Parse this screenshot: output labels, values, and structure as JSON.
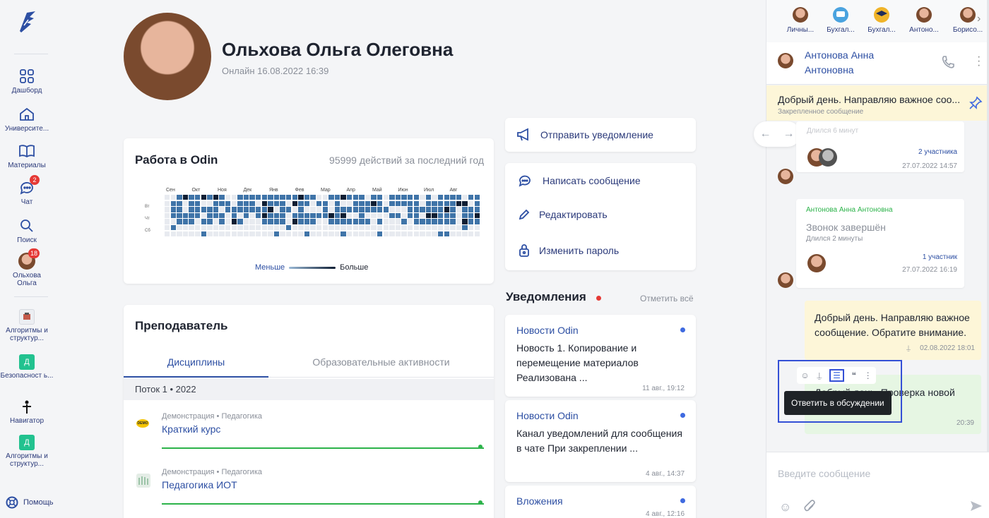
{
  "nav": {
    "items": [
      {
        "label": "Дашборд",
        "icon": "dashboard-icon"
      },
      {
        "label": "Университе...",
        "icon": "university-icon"
      },
      {
        "label": "Материалы",
        "icon": "book-icon"
      },
      {
        "label": "Чат",
        "icon": "chat-icon",
        "badge": "2"
      },
      {
        "label": "Поиск",
        "icon": "search-icon"
      },
      {
        "label": "Ольхова\nОльга",
        "icon": "avatar",
        "badge": "18"
      }
    ],
    "groups": [
      {
        "label": "Алгоритмы и структур...",
        "tile": ""
      },
      {
        "label": "Безопасност ь...",
        "tile": "Д"
      },
      {
        "label": "Навигатор",
        "tile": ""
      },
      {
        "label": "Алгоритмы и структур...",
        "tile": "Д"
      }
    ],
    "help": "Помощь"
  },
  "profile": {
    "name": "Ольхова Ольга Олеговна",
    "status": "Онлайн 16.08.2022 16:39"
  },
  "activity": {
    "title": "Работа в Odin",
    "summary": "95999 действий за последний год",
    "months": [
      "Сен",
      "Окт",
      "Ноя",
      "Дек",
      "Янв",
      "Фев",
      "Мар",
      "Апр",
      "Май",
      "Июн",
      "Июл",
      "Авг"
    ],
    "days": [
      "Вт",
      "Чт",
      "Сб"
    ],
    "legend_less": "Меньше",
    "legend_more": "Больше"
  },
  "actions": {
    "notify": "Отправить уведомление",
    "message": "Написать сообщение",
    "edit": "Редактировать",
    "password": "Изменить пароль"
  },
  "teacher": {
    "title": "Преподаватель",
    "tabs": [
      "Дисциплины",
      "Образовательные активности"
    ],
    "stream": "Поток 1 • 2022",
    "courses": [
      {
        "meta": "Демонстрация • Педагогика",
        "name": "Краткий курс"
      },
      {
        "meta": "Демонстрация • Педагогика",
        "name": "Педагогика ИОТ"
      }
    ]
  },
  "notifications": {
    "title": "Уведомления",
    "mark_all": "Отметить всё",
    "items": [
      {
        "title": "Новости Odin",
        "body": "Новость 1. Копирование и перемещение материалов Реализована ...",
        "time": "11 авг., 19:12"
      },
      {
        "title": "Новости Odin",
        "body": "Канал уведомлений для сообщения в чате При закреплении ...",
        "time": "4 авг., 14:37"
      },
      {
        "title": "Вложения",
        "body": "",
        "time": "4 авг., 12:16"
      }
    ]
  },
  "chat": {
    "contacts": [
      "Личны...",
      "Бухгал...",
      "Бухгал...",
      "Антоно...",
      "Борисо..."
    ],
    "peer_name_line1": "Антонова Анна",
    "peer_name_line2": "Антоновна",
    "pinned_text": "Добрый день. Направляю важное соо...",
    "pinned_label": "Закрепленное сообщение",
    "call1_partial": "Длился 6 минут",
    "call1_participants": "2 участника",
    "call1_date": "27.07.2022 14:57",
    "call2_author": "Антонова Анна Антоновна",
    "call2_title": "Звонок завершён",
    "call2_duration": "Длился 2 минуты",
    "call2_participants": "1 участник",
    "call2_date": "27.07.2022 16:19",
    "msg1_text": "Добрый день. Направляю важное сообщение. Обратите внимание.",
    "msg1_date": "02.08.2022 18:01",
    "msg2_text": "Добрый день. Проверка новой функции.",
    "msg2_time": "20:39",
    "tooltip": "Ответить в обсуждении",
    "input_placeholder": "Введите сообщение"
  },
  "colors": {
    "accent": "#2d4fa3",
    "heat_low": "#dfe3ea",
    "heat_mid": "#3f74a8",
    "heat_high": "#0f1e33",
    "pinned_bg": "#fdf6d8",
    "outgoing_bg": "#fdf6d8",
    "green_bubble": "#e6f6e3",
    "progress_green": "#2cb34a",
    "highlight_box": "#3450d6"
  }
}
